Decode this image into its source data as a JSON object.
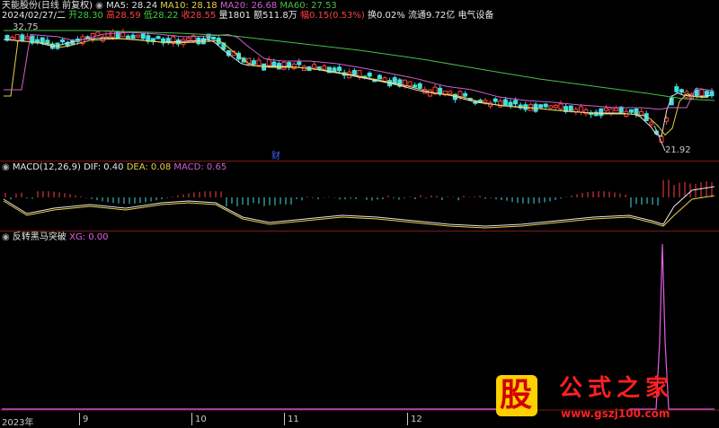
{
  "header": {
    "stock_name": "天能股份",
    "adjust": "(日线 前复权)",
    "ma": [
      {
        "label": "MA5: 28.24",
        "color": "#e0e0e0"
      },
      {
        "label": "MA10: 28.18",
        "color": "#e8d048"
      },
      {
        "label": "MA20: 26.68",
        "color": "#d060d0"
      },
      {
        "label": "MA60: 27.53",
        "color": "#48c048"
      }
    ],
    "date": "2024/02/27/二",
    "open_label": "开28.30",
    "high_label": "高28.59",
    "low_label": "低28.22",
    "close_label": "收28.55",
    "vol_label": "量1801",
    "amount_label": "额511.8万",
    "change_label": "幅0.15(0.53%)",
    "turnover_label": "换0.02%",
    "float_label": "流通9.72亿",
    "sector": "电气设备",
    "price_label": "32.75"
  },
  "price_panel": {
    "low_marker": "21.92",
    "event_marker": "财"
  },
  "macd": {
    "title": "MACD(12,26,9)",
    "dif": "DIF: 0.40",
    "dea": "DEA: 0.08",
    "macd": "MACD: 0.65"
  },
  "indicator": {
    "title": "反转黑马突破",
    "xg": "XG: 0.00"
  },
  "xaxis": {
    "ticks": [
      "2023年",
      "9",
      "10",
      "11",
      "12"
    ]
  },
  "watermark": {
    "logo": "股",
    "name": "公式之家",
    "url": "www.gszj100.com"
  },
  "colors": {
    "up": "#ff4040",
    "down": "#40e0e0",
    "divider": "#7a1a1a",
    "xg_spike": "#e060e0"
  }
}
